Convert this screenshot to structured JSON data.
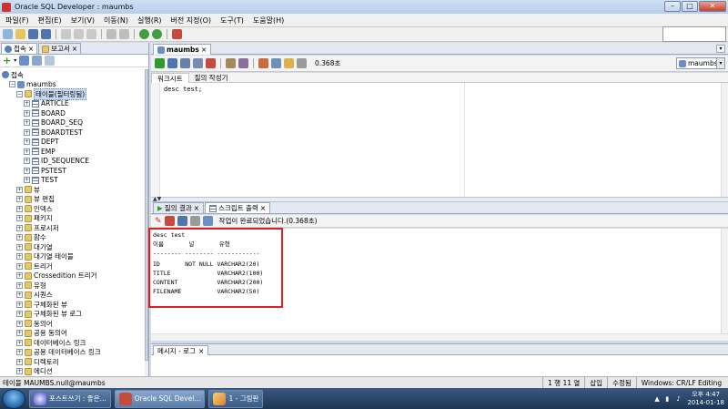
{
  "window": {
    "title": "Oracle SQL Developer : maumbs"
  },
  "menu": [
    "파일(F)",
    "편집(E)",
    "보기(V)",
    "이동(N)",
    "실행(R)",
    "버전 지정(O)",
    "도구(T)",
    "도움말(H)"
  ],
  "left_panel": {
    "tabs": [
      "접속",
      "보고서"
    ],
    "tree": [
      {
        "label": "접속",
        "depth": 0,
        "kind": "conn",
        "expander": ""
      },
      {
        "label": "maumbs",
        "depth": 1,
        "kind": "db",
        "expander": "−"
      },
      {
        "label": "테이블(필터링됨)",
        "depth": 2,
        "kind": "folder",
        "expander": "−",
        "selected": true
      },
      {
        "label": "ARTICLE",
        "depth": 3,
        "kind": "table",
        "expander": "+"
      },
      {
        "label": "BOARD",
        "depth": 3,
        "kind": "table",
        "expander": "+"
      },
      {
        "label": "BOARD_SEQ",
        "depth": 3,
        "kind": "table",
        "expander": "+"
      },
      {
        "label": "BOARDTEST",
        "depth": 3,
        "kind": "table",
        "expander": "+"
      },
      {
        "label": "DEPT",
        "depth": 3,
        "kind": "table",
        "expander": "+"
      },
      {
        "label": "EMP",
        "depth": 3,
        "kind": "table",
        "expander": "+"
      },
      {
        "label": "ID_SEQUENCE",
        "depth": 3,
        "kind": "table",
        "expander": "+"
      },
      {
        "label": "PSTEST",
        "depth": 3,
        "kind": "table",
        "expander": "+"
      },
      {
        "label": "TEST",
        "depth": 3,
        "kind": "table",
        "expander": "+"
      },
      {
        "label": "뷰",
        "depth": 2,
        "kind": "folder",
        "expander": "+"
      },
      {
        "label": "뷰 편집",
        "depth": 2,
        "kind": "folder",
        "expander": "+"
      },
      {
        "label": "인덱스",
        "depth": 2,
        "kind": "folder",
        "expander": "+"
      },
      {
        "label": "패키지",
        "depth": 2,
        "kind": "folder",
        "expander": "+"
      },
      {
        "label": "프로시저",
        "depth": 2,
        "kind": "folder",
        "expander": "+"
      },
      {
        "label": "함수",
        "depth": 2,
        "kind": "folder",
        "expander": "+"
      },
      {
        "label": "대기열",
        "depth": 2,
        "kind": "folder",
        "expander": "+"
      },
      {
        "label": "대기열 테이블",
        "depth": 2,
        "kind": "folder",
        "expander": "+"
      },
      {
        "label": "트리거",
        "depth": 2,
        "kind": "folder",
        "expander": "+"
      },
      {
        "label": "Crossedition 트리거",
        "depth": 2,
        "kind": "folder",
        "expander": "+"
      },
      {
        "label": "유형",
        "depth": 2,
        "kind": "folder",
        "expander": "+"
      },
      {
        "label": "시퀀스",
        "depth": 2,
        "kind": "folder",
        "expander": "+"
      },
      {
        "label": "구체화된 뷰",
        "depth": 2,
        "kind": "folder",
        "expander": "+"
      },
      {
        "label": "구체화된 뷰 로그",
        "depth": 2,
        "kind": "folder",
        "expander": "+"
      },
      {
        "label": "동의어",
        "depth": 2,
        "kind": "folder",
        "expander": "+"
      },
      {
        "label": "공용 동의어",
        "depth": 2,
        "kind": "folder",
        "expander": "+"
      },
      {
        "label": "데이터베이스 링크",
        "depth": 2,
        "kind": "folder",
        "expander": "+"
      },
      {
        "label": "공용 데이터베이스 링크",
        "depth": 2,
        "kind": "folder",
        "expander": "+"
      },
      {
        "label": "디렉토리",
        "depth": 2,
        "kind": "folder",
        "expander": "+"
      },
      {
        "label": "에디션",
        "depth": 2,
        "kind": "folder",
        "expander": "+"
      }
    ]
  },
  "editor": {
    "tab": "maumbs",
    "timing": "0.368초",
    "connection": "maumbs",
    "subtabs": [
      "워크시트",
      "질의 작성기"
    ],
    "sql": "desc test;"
  },
  "results": {
    "tabs": [
      "질의 결과",
      "스크립트 출력"
    ],
    "message": "작업이 완료되었습니다.(0.368초)",
    "lines": [
      "desc test",
      "이름       널       유형",
      "-------- -------- ------------",
      "ID       NOT NULL VARCHAR2(20)",
      "TITLE             VARCHAR2(100)",
      "CONTENT           VARCHAR2(200)",
      "FILENAME          VARCHAR2(50)"
    ]
  },
  "log": {
    "tab": "메시지 - 로그"
  },
  "status": {
    "left": "테이블 MAUMBS.null@maumbs",
    "position": "1 행 11 열",
    "insert": "삽입",
    "modified": "수정됨",
    "eol": "Windows: CR/LF Editing"
  },
  "taskbar": {
    "items": [
      "포스트쓰기 : 좋은...",
      "Oracle SQL Devel...",
      "1 - 그림판"
    ],
    "time": "오후 4:47",
    "date": "2014-01-18"
  },
  "colors": {
    "highlight_box": "#e02020",
    "selection": "#c9daf3"
  }
}
